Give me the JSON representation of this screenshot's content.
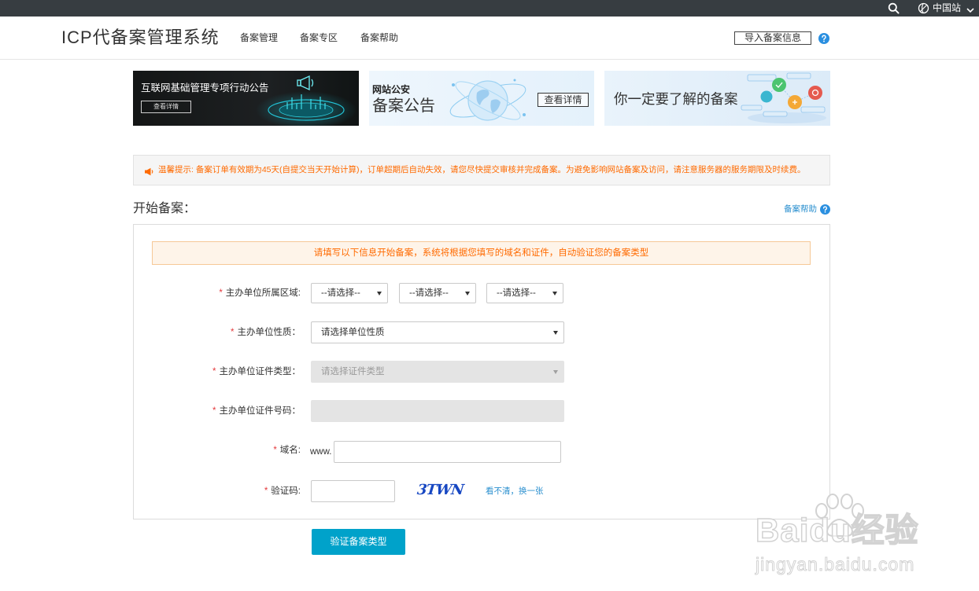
{
  "topbar": {
    "region_label": "中国站",
    "icons": {
      "search": "search-icon",
      "region": "globe-icon",
      "dropdown": "chevron-down-icon"
    }
  },
  "header": {
    "title": "ICP代备案管理系统",
    "nav": [
      {
        "label": "备案管理"
      },
      {
        "label": "备案专区"
      },
      {
        "label": "备案帮助"
      }
    ],
    "import_button": "导入备案信息",
    "help_icon": "question-circle-icon"
  },
  "banners": [
    {
      "title": "互联网基础管理专项行动公告",
      "button": "查看详情"
    },
    {
      "subtitle": "网站公安",
      "title": "备案公告",
      "button": "查看详情"
    },
    {
      "title": "你一定要了解的备案"
    }
  ],
  "notice": {
    "icon": "megaphone-icon",
    "text": "温馨提示: 备案订单有效期为45天(自提交当天开始计算)，订单超期后自动失效，请您尽快提交审核并完成备案。为避免影响网站备案及访问，请注意服务器的服务期限及时续费。"
  },
  "section": {
    "title": "开始备案：",
    "help_link": "备案帮助"
  },
  "form": {
    "info": "请填写以下信息开始备案，系统将根据您填写的域名和证件，自动验证您的备案类型",
    "required_mark": "*",
    "region": {
      "label": "主办单位所属区域:",
      "selects": [
        "--请选择--",
        "--请选择--",
        "--请选择--"
      ]
    },
    "org_type": {
      "label": "主办单位性质：",
      "value": "请选择单位性质"
    },
    "cert_type": {
      "label": "主办单位证件类型：",
      "value": "请选择证件类型",
      "disabled": true
    },
    "cert_no": {
      "label": "主办单位证件号码：",
      "value": "",
      "disabled": true
    },
    "domain": {
      "label": "域名:",
      "prefix": "www.",
      "value": ""
    },
    "captcha": {
      "label": "验证码:",
      "value": "",
      "image_text": "3TWN",
      "refresh_link": "看不清，换一张"
    },
    "submit": "验证备案类型"
  },
  "colors": {
    "topbar": "#373d41",
    "accent": "#00a2ca",
    "notice_text": "#ff6a00",
    "link": "#2a8fcf",
    "required": "#e4393c",
    "help_icon": "#2a8fe0"
  },
  "watermark": {
    "logo": "Baidu经验",
    "url": "jingyan.baidu.com"
  }
}
